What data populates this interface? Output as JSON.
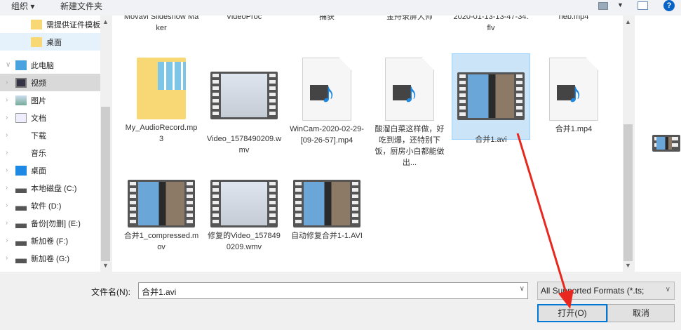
{
  "toolbar": {
    "organize": "组织 ▾",
    "new_folder": "新建文件夹"
  },
  "nav": {
    "items": [
      {
        "label": "需提供证件模板",
        "icon": "folder-icon"
      },
      {
        "label": "桌面",
        "icon": "folder-icon",
        "highlight": true
      },
      {
        "label": "此电脑",
        "icon": "computer-icon"
      },
      {
        "label": "视频",
        "icon": "video-icon",
        "selected": true
      },
      {
        "label": "图片",
        "icon": "pictures-icon"
      },
      {
        "label": "文档",
        "icon": "documents-icon"
      },
      {
        "label": "下载",
        "icon": "download-icon"
      },
      {
        "label": "音乐",
        "icon": "music-icon"
      },
      {
        "label": "桌面",
        "icon": "desktop-icon"
      },
      {
        "label": "本地磁盘 (C:)",
        "icon": "drive-icon"
      },
      {
        "label": "软件 (D:)",
        "icon": "drive-icon"
      },
      {
        "label": "备份[勿删] (E:)",
        "icon": "drive-icon"
      },
      {
        "label": "新加卷 (F:)",
        "icon": "drive-icon"
      },
      {
        "label": "新加卷 (G:)",
        "icon": "drive-icon"
      }
    ]
  },
  "files": [
    {
      "name": "Movavi Slideshow Maker",
      "type": "none"
    },
    {
      "name": "VideoProc",
      "type": "none"
    },
    {
      "name": "捕获",
      "type": "none"
    },
    {
      "name": "金舟录屏大师",
      "type": "none"
    },
    {
      "name": "2020-01-13-13-47-34.flv",
      "type": "none"
    },
    {
      "name": "heb.mp4",
      "type": "none"
    },
    {
      "name": "My_AudioRecord.mp3",
      "type": "folder"
    },
    {
      "name": "Video_1578490209.wmv",
      "type": "wmv"
    },
    {
      "name": "WinCam-2020-02-29-[09-26-57].mp4",
      "type": "media"
    },
    {
      "name": "酸溜白菜这样做，好吃到爆，还特别下饭，厨房小白都能做出...",
      "type": "media"
    },
    {
      "name": "合并1.avi",
      "type": "video",
      "selected": true
    },
    {
      "name": "合并1.mp4",
      "type": "media"
    },
    {
      "name": "合并1_compressed.mov",
      "type": "video"
    },
    {
      "name": "修复的Video_1578490209.wmv",
      "type": "wmv"
    },
    {
      "name": "自动修复合并1-1.AVI",
      "type": "video"
    }
  ],
  "footer": {
    "filename_label": "文件名(N):",
    "filename_value": "合并1.avi",
    "filetype": "All Supported Formats (*.ts;",
    "open": "打开(O)",
    "cancel": "取消"
  }
}
